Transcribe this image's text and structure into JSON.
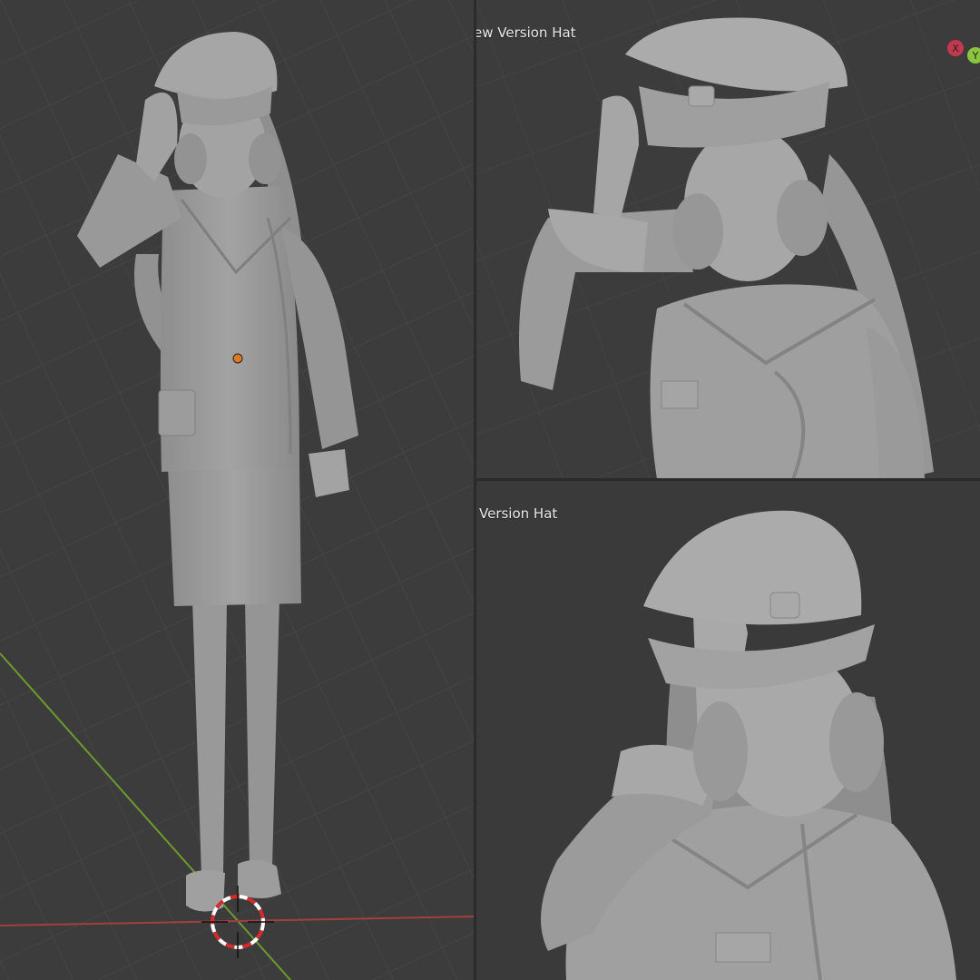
{
  "viewports": {
    "top_right": {
      "label": "ew Version Hat"
    },
    "bottom_right": {
      "label": "Version Hat"
    }
  },
  "gizmo": {
    "x_label": "X",
    "y_label": "Y",
    "x_color": "#c2384d",
    "y_color": "#8bc53f"
  },
  "colors": {
    "background": "#3c3c3c",
    "grid": "#474747",
    "model": "#9a9a9a",
    "axis_x": "#a33f3f",
    "axis_y": "#6d9b2c",
    "origin": "#e07a1f"
  }
}
